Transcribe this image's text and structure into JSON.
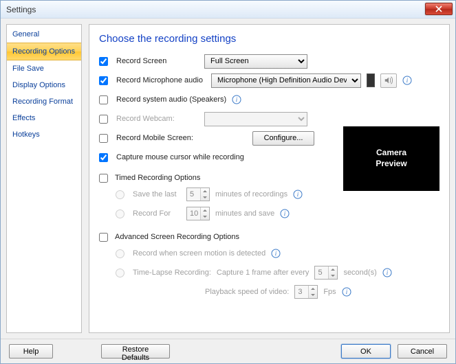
{
  "window": {
    "title": "Settings"
  },
  "sidebar": {
    "items": [
      {
        "label": "General"
      },
      {
        "label": "Recording Options"
      },
      {
        "label": "File Save"
      },
      {
        "label": "Display Options"
      },
      {
        "label": "Recording Format"
      },
      {
        "label": "Effects"
      },
      {
        "label": "Hotkeys"
      }
    ],
    "selected_index": 1
  },
  "main": {
    "heading": "Choose the recording settings",
    "record_screen": {
      "label": "Record Screen",
      "checked": true,
      "mode": "Full Screen"
    },
    "record_mic": {
      "label": "Record Microphone audio",
      "checked": true,
      "device": "Microphone (High Definition Audio Device)"
    },
    "record_system_audio": {
      "label": "Record system audio (Speakers)",
      "checked": false
    },
    "record_webcam": {
      "label": "Record Webcam:",
      "checked": false,
      "device": ""
    },
    "record_mobile": {
      "label": "Record Mobile Screen:",
      "checked": false,
      "configure": "Configure..."
    },
    "capture_cursor": {
      "label": "Capture mouse cursor while recording",
      "checked": true
    },
    "camera_preview": "Camera\nPreview",
    "timed": {
      "label": "Timed Recording Options",
      "checked": false,
      "save_last": {
        "label": "Save the last",
        "value": "5",
        "suffix": "minutes of recordings"
      },
      "record_for": {
        "label": "Record For",
        "value": "10",
        "suffix": "minutes and save"
      }
    },
    "advanced": {
      "label": "Advanced Screen Recording Options",
      "checked": false,
      "motion": {
        "label": "Record when screen motion is detected"
      },
      "timelapse": {
        "label": "Time-Lapse Recording:",
        "capture_prefix": "Capture 1 frame after every",
        "capture_value": "5",
        "capture_suffix": "second(s)",
        "playback_prefix": "Playback speed of video:",
        "playback_value": "3",
        "playback_suffix": "Fps"
      }
    }
  },
  "footer": {
    "help": "Help",
    "restore": "Restore Defaults",
    "ok": "OK",
    "cancel": "Cancel"
  }
}
